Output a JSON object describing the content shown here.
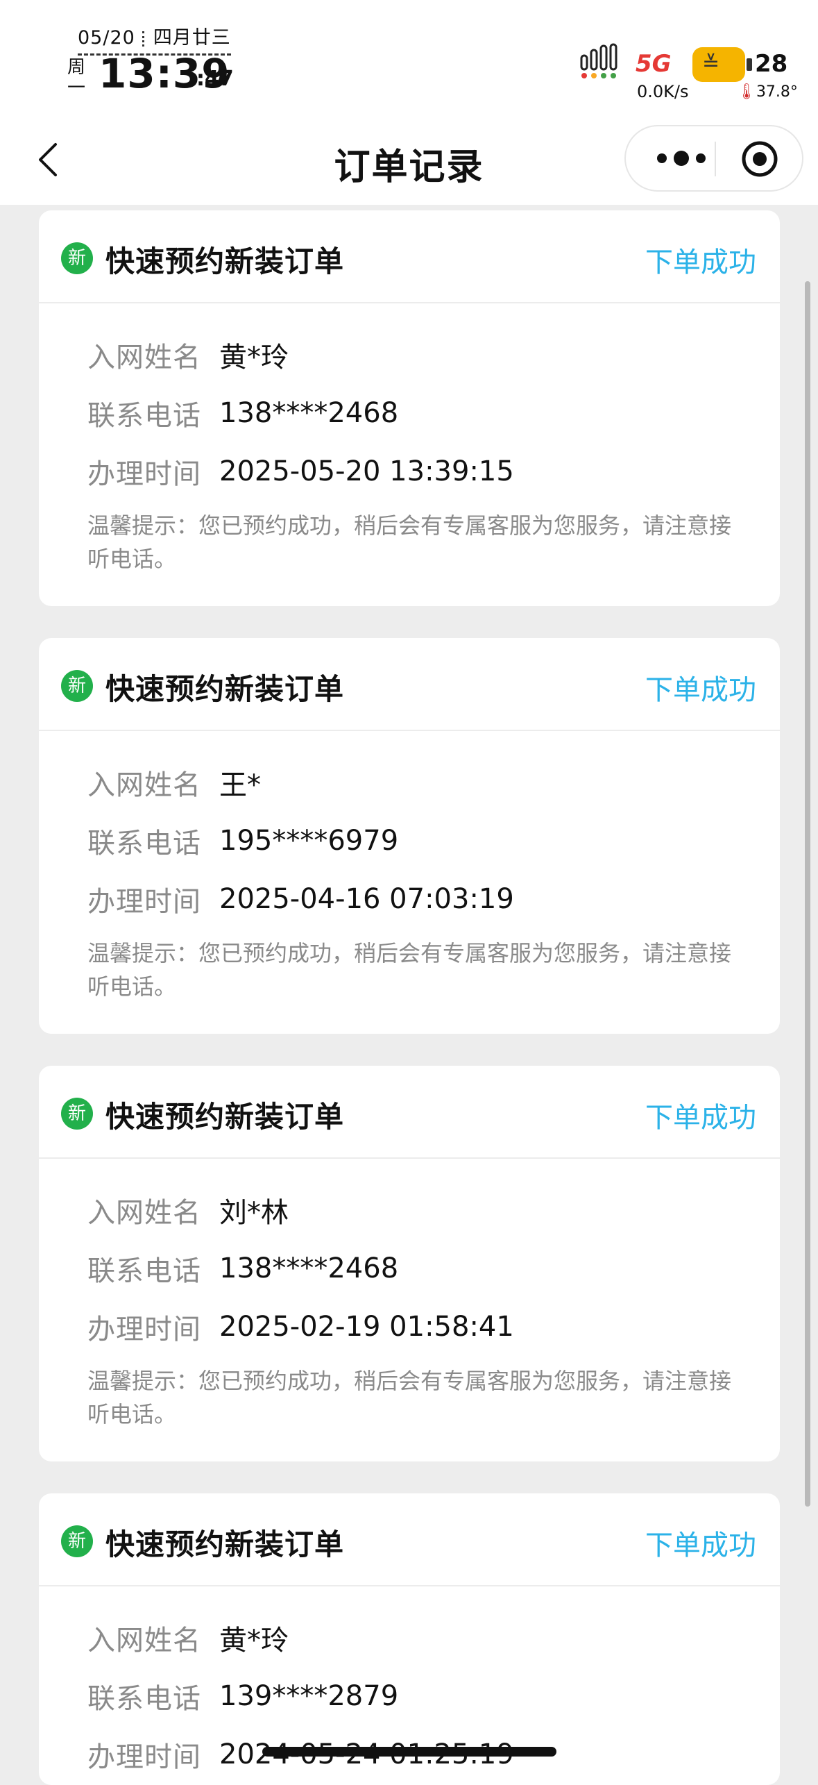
{
  "status_bar": {
    "date": "05/20",
    "lunar": "四月廿三",
    "weekday": "周一",
    "time": "13:39",
    "seconds": ":47",
    "network": "5G",
    "speed": "0.0K/s",
    "battery": "28",
    "temperature": "37.8°"
  },
  "nav": {
    "title": "订单记录"
  },
  "orders": [
    {
      "badge": "新",
      "title": "快速预约新装订单",
      "status": "下单成功",
      "name_label": "入网姓名",
      "name": "黄*玲",
      "phone_label": "联系电话",
      "phone": "138****2468",
      "time_label": "办理时间",
      "time": "2025-05-20 13:39:15",
      "tip": "温馨提示：您已预约成功，稍后会有专属客服为您服务，请注意接听电话。"
    },
    {
      "badge": "新",
      "title": "快速预约新装订单",
      "status": "下单成功",
      "name_label": "入网姓名",
      "name": "王*",
      "phone_label": "联系电话",
      "phone": "195****6979",
      "time_label": "办理时间",
      "time": "2025-04-16 07:03:19",
      "tip": "温馨提示：您已预约成功，稍后会有专属客服为您服务，请注意接听电话。"
    },
    {
      "badge": "新",
      "title": "快速预约新装订单",
      "status": "下单成功",
      "name_label": "入网姓名",
      "name": "刘*林",
      "phone_label": "联系电话",
      "phone": "138****2468",
      "time_label": "办理时间",
      "time": "2025-02-19 01:58:41",
      "tip": "温馨提示：您已预约成功，稍后会有专属客服为您服务，请注意接听电话。"
    },
    {
      "badge": "新",
      "title": "快速预约新装订单",
      "status": "下单成功",
      "name_label": "入网姓名",
      "name": "黄*玲",
      "phone_label": "联系电话",
      "phone": "139****2879",
      "time_label": "办理时间",
      "time": "2024-05-24 01:25:19",
      "tip": ""
    }
  ],
  "colors": {
    "status_accent": "#2bb2e8",
    "badge_green": "#22b04b",
    "page_bg": "#ededed"
  }
}
